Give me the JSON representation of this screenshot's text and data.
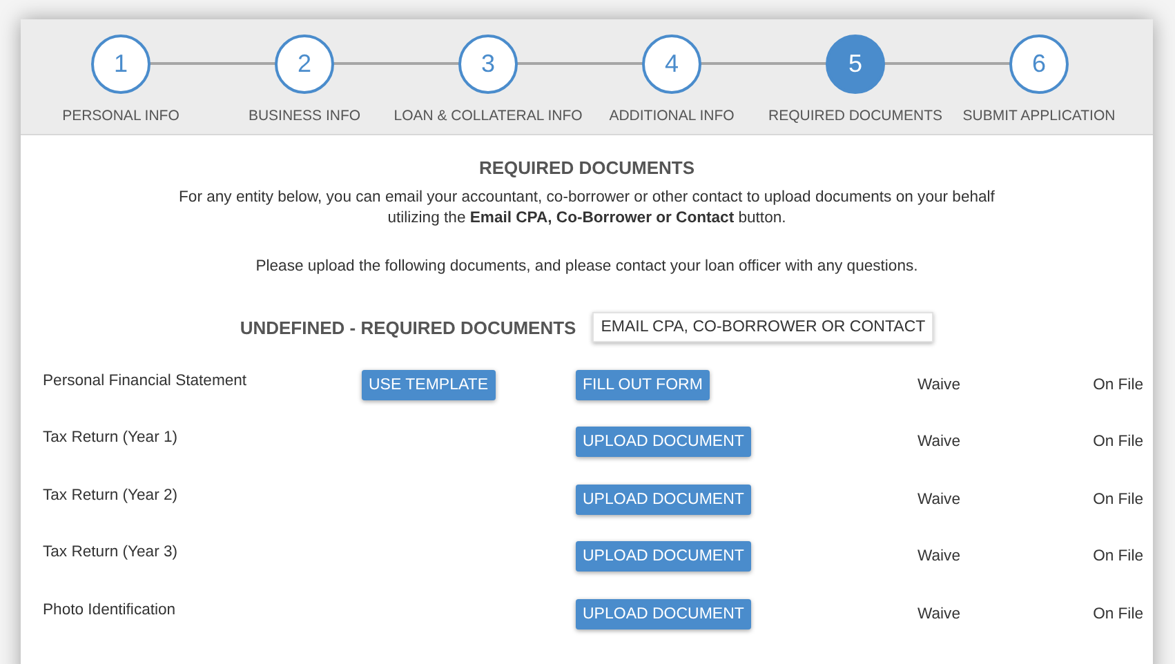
{
  "steps": [
    {
      "number": "1",
      "label": "PERSONAL INFO",
      "selected": false
    },
    {
      "number": "2",
      "label": "BUSINESS INFO",
      "selected": false
    },
    {
      "number": "3",
      "label": "LOAN & COLLATERAL INFO",
      "selected": false
    },
    {
      "number": "4",
      "label": "ADDITIONAL INFO",
      "selected": false
    },
    {
      "number": "5",
      "label": "REQUIRED DOCUMENTS",
      "selected": true
    },
    {
      "number": "6",
      "label": "SUBMIT APPLICATION",
      "selected": false
    }
  ],
  "title": "REQUIRED DOCUMENTS",
  "intro": "For any entity below, you can email your accountant, co-borrower or other contact to upload documents on your behalf utilizing the **Email CPA, Co-Borrower or Contact** button.",
  "note": "Please upload the following documents, and please contact your loan officer with any questions.",
  "group": {
    "heading": "UNDEFINED - REQUIRED DOCUMENTS",
    "email_button": "EMAIL CPA, CO-BORROWER OR CONTACT"
  },
  "documents": [
    {
      "name": "Personal Financial Statement",
      "buttons": [
        {
          "kind": "template",
          "label": "USE TEMPLATE"
        },
        {
          "kind": "action",
          "label": "FILL OUT FORM"
        }
      ],
      "waive": "Waive",
      "on_file": "On File"
    },
    {
      "name": "Tax Return (Year 1)",
      "buttons": [
        {
          "kind": "action",
          "label": "UPLOAD DOCUMENT"
        }
      ],
      "waive": "Waive",
      "on_file": "On File"
    },
    {
      "name": "Tax Return (Year 2)",
      "buttons": [
        {
          "kind": "action",
          "label": "UPLOAD DOCUMENT"
        }
      ],
      "waive": "Waive",
      "on_file": "On File"
    },
    {
      "name": "Tax Return (Year 3)",
      "buttons": [
        {
          "kind": "action",
          "label": "UPLOAD DOCUMENT"
        }
      ],
      "waive": "Waive",
      "on_file": "On File"
    },
    {
      "name": "Photo Identification",
      "buttons": [
        {
          "kind": "action",
          "label": "UPLOAD DOCUMENT"
        }
      ],
      "waive": "Waive",
      "on_file": "On File"
    }
  ]
}
